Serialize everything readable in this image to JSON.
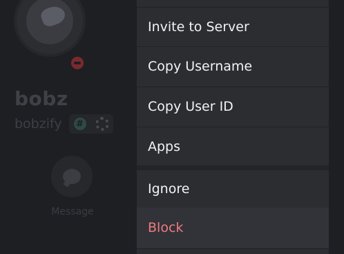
{
  "profile": {
    "display_name": "bobz",
    "username": "bobzify",
    "badge_hash_symbol": "#",
    "message_label": "Message"
  },
  "menu": {
    "items": [
      {
        "label": "Invite to Server"
      },
      {
        "label": "Copy Username"
      },
      {
        "label": "Copy User ID"
      },
      {
        "label": "Apps"
      },
      {
        "label": "Ignore"
      },
      {
        "label": "Block"
      }
    ]
  },
  "colors": {
    "menu_bg": "#2b2d31",
    "danger_text": "#f07a7f",
    "menu_text": "#f2f3f5"
  }
}
